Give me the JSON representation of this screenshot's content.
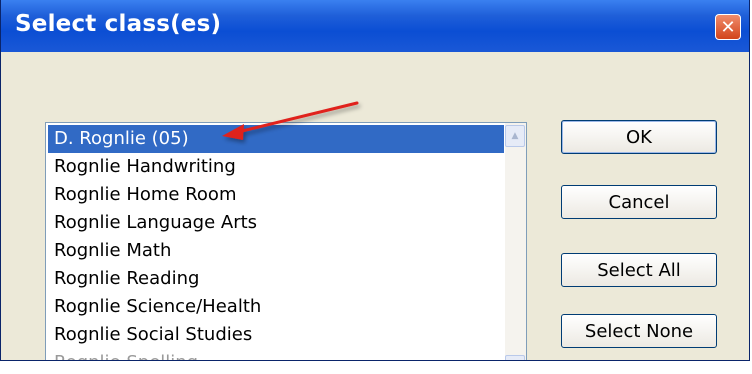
{
  "window": {
    "title": "Select class(es)",
    "close_glyph": "✕"
  },
  "class_list": {
    "items": [
      {
        "label": "D. Rognlie (05)",
        "selected": true
      },
      {
        "label": "Rognlie Handwriting",
        "selected": false
      },
      {
        "label": "Rognlie Home Room",
        "selected": false
      },
      {
        "label": "Rognlie Language Arts",
        "selected": false
      },
      {
        "label": "Rognlie Math",
        "selected": false
      },
      {
        "label": "Rognlie Reading",
        "selected": false
      },
      {
        "label": "Rognlie Science/Health",
        "selected": false
      },
      {
        "label": "Rognlie Social Studies",
        "selected": false
      },
      {
        "label": "Rognlie Spelling",
        "selected": false
      }
    ]
  },
  "buttons": {
    "ok": "OK",
    "cancel": "Cancel",
    "select_all": "Select All",
    "select_none": "Select None"
  },
  "colors": {
    "title_bar": "#0b4ed4",
    "selection": "#316ac5",
    "annotation_arrow": "#e0201c",
    "dialog_bg": "#ece9d8"
  },
  "icons": {
    "close": "close-icon",
    "scroll_up": "scroll-up-arrow-icon",
    "annotation": "red-arrow-icon"
  }
}
